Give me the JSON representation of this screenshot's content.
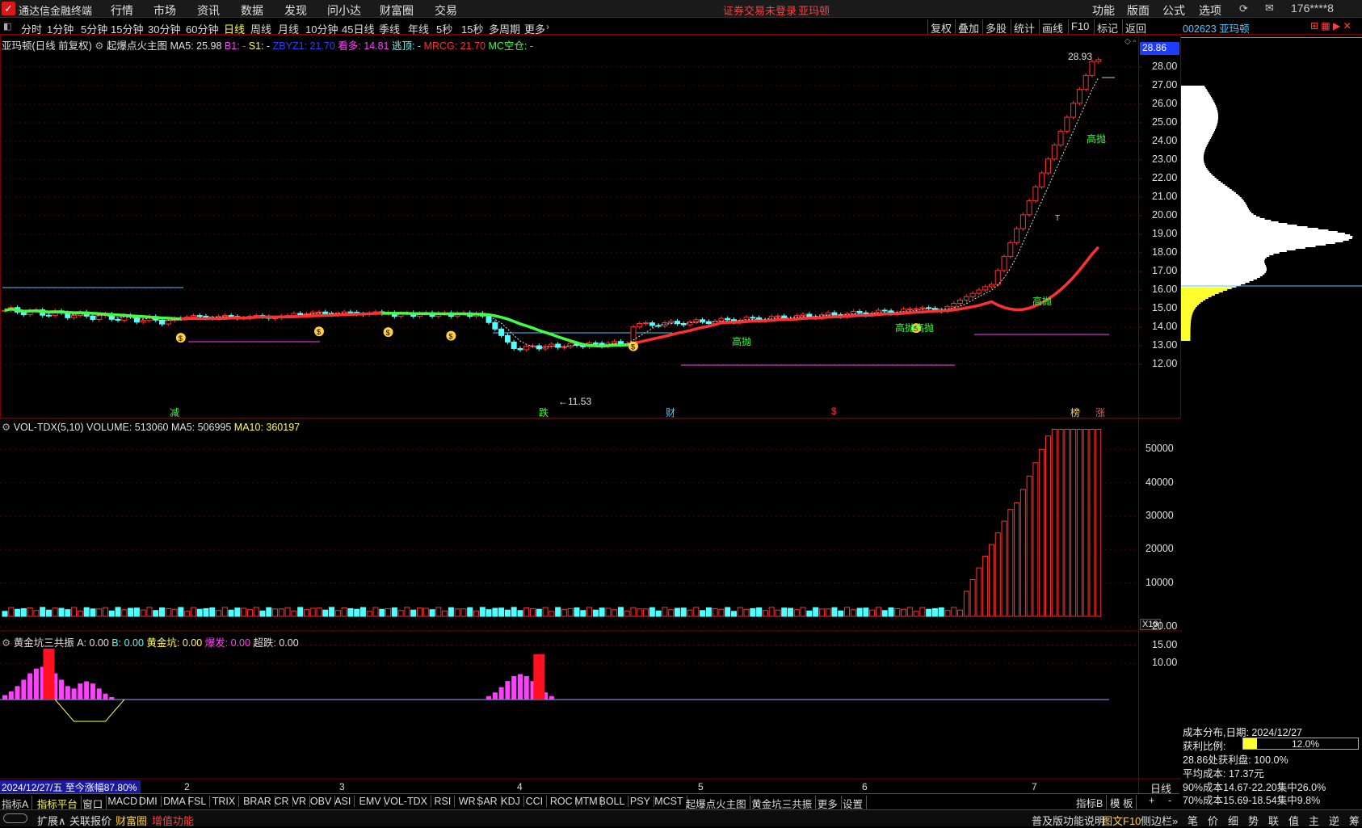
{
  "app": {
    "title": "通达信金融终端",
    "notice": "证券交易未登录",
    "notice_stock": "亚玛顿",
    "user": "176****8"
  },
  "menus": [
    "行情",
    "市场",
    "资讯",
    "数据",
    "发现",
    "问小达",
    "财富圈",
    "交易"
  ],
  "right_menus": [
    "功能",
    "版面",
    "公式",
    "选项"
  ],
  "periods": [
    "分时",
    "1分钟",
    "5分钟",
    "15分钟",
    "30分钟",
    "60分钟",
    "日线",
    "周线",
    "月线",
    "10分钟",
    "45日线",
    "季线",
    "年线",
    "5秒",
    "15秒",
    "多周期",
    "更多"
  ],
  "active_period": "日线",
  "toolbar_buttons": [
    "复权",
    "叠加",
    "多股",
    "统计",
    "画线",
    "F10",
    "标记",
    "返回"
  ],
  "main_header": {
    "stock": "亚玛顿(日线 前复权)",
    "indicator": "起爆点火主图",
    "items": [
      {
        "label": "MA5: 25.98",
        "color": "#e0e0e0"
      },
      {
        "label": "B1: -",
        "color": "#ff40ff"
      },
      {
        "label": "S1: -",
        "color": "#ffff50"
      },
      {
        "label": "ZBYZ1: 21.70",
        "color": "#3040ff"
      },
      {
        "label": "看多: 14.81",
        "color": "#ff40ff"
      },
      {
        "label": "逃顶: -",
        "color": "#50ffff"
      },
      {
        "label": "MRCG: 21.70",
        "color": "#ff3030"
      },
      {
        "label": "MC空仓: -",
        "color": "#40ff40"
      }
    ]
  },
  "price_axis": [
    "28.00",
    "27.00",
    "26.00",
    "25.00",
    "24.00",
    "23.00",
    "22.00",
    "21.00",
    "20.00",
    "19.00",
    "18.00",
    "17.00",
    "16.00",
    "15.00",
    "14.00",
    "13.00",
    "12.00"
  ],
  "current_price": "28.86",
  "high_label": "28.93",
  "low_label": "11.53",
  "signal_labels": {
    "s1": "减",
    "s2": "跌",
    "s3": "财",
    "s4": "$",
    "s5": "榜",
    "s6": "涨"
  },
  "chart_annotations": {
    "a1": "高抛",
    "a2": "高抛",
    "a3": "高抛高抛",
    "a4": "高抛",
    "t": "T"
  },
  "volume_header": {
    "name": "VOL-TDX(5,10)",
    "items": [
      {
        "label": "VOLUME: 513060",
        "color": "#e0e0e0"
      },
      {
        "label": "MA5: 506995",
        "color": "#e0e0e0"
      },
      {
        "label": "MA10: 360197",
        "color": "#ffff50"
      }
    ]
  },
  "volume_axis": [
    "50000",
    "40000",
    "30000",
    "20000",
    "10000"
  ],
  "volume_unit": "X10",
  "ind_header": {
    "name": "黄金坑三共振",
    "items": [
      {
        "label": "A: 0.00",
        "color": "#e0e0e0"
      },
      {
        "label": "B: 0.00",
        "color": "#50ffff"
      },
      {
        "label": "黄金坑: 0.00",
        "color": "#ffff50"
      },
      {
        "label": "爆发: 0.00",
        "color": "#ff40ff"
      },
      {
        "label": "超跌: 0.00",
        "color": "#e0e0e0"
      }
    ]
  },
  "ind_axis": [
    "20.00",
    "15.00",
    "10.00"
  ],
  "time_info": "2024/12/27/五  至今涨幅87.80%",
  "months": [
    "2",
    "3",
    "4",
    "5",
    "6",
    "7"
  ],
  "period_label": "日线",
  "indicator_tabs": [
    "指标A",
    "指标平台",
    "窗口",
    "MACD",
    "DMI",
    "DMA",
    "FSL",
    "TRIX",
    "BRAR",
    "CR",
    "VR",
    "OBV",
    "ASI",
    "EMV",
    "VOL-TDX",
    "RSI",
    "WR",
    "SAR",
    "KDJ",
    "CCI",
    "ROC",
    "MTM",
    "BOLL",
    "PSY",
    "MCST",
    "起爆点火主图",
    "黄金坑三共振",
    "更多",
    "设置"
  ],
  "indicator_b": [
    "指标B",
    "模 板",
    "+",
    "-"
  ],
  "status_left": [
    "扩展∧",
    "关联报价",
    "财富圈",
    "增值功能"
  ],
  "status_right": [
    "普及版功能说明",
    "图文F10",
    "侧边栏»"
  ],
  "side": {
    "code": "002623 亚玛顿",
    "dist_title": "成本分布,日期: 2024/12/27",
    "profit_ratio_label": "获利比例:",
    "profit_ratio_value": "12.0%",
    "profit_line": "28.86处获利盘: 100.0%",
    "avg_cost": "平均成本: 17.37元",
    "cost90": "90%成本14.67-22.20集中26.0%",
    "cost70": "70%成本15.69-18.54集中9.8%",
    "tabs": [
      "笔",
      "价",
      "细",
      "势",
      "联",
      "值",
      "主",
      "逆",
      "筹"
    ]
  }
}
